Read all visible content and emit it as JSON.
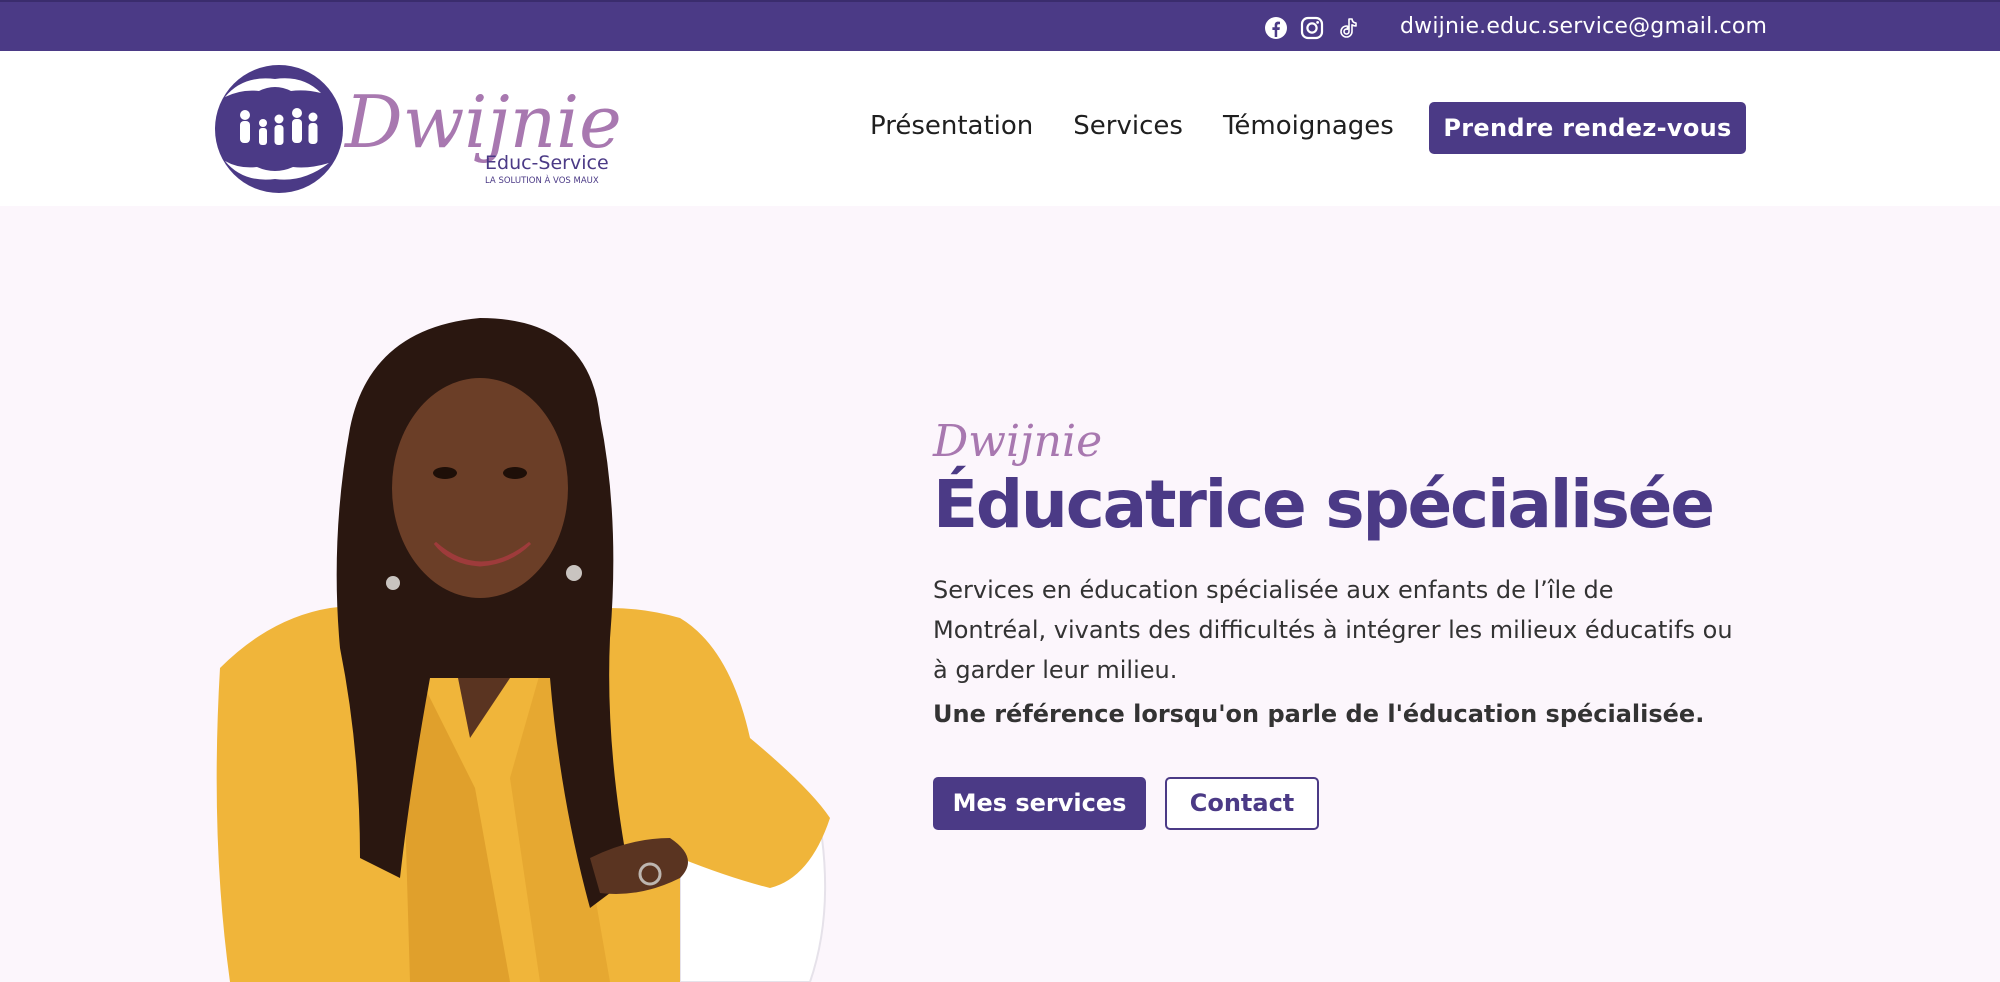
{
  "colors": {
    "brand_purple": "#4b3a86",
    "accent_lilac": "#a878b0",
    "hero_bg": "#fcf6fc",
    "jacket_yellow": "#f0b53a"
  },
  "topbar": {
    "social_icons": [
      "facebook-icon",
      "instagram-icon",
      "tiktok-icon"
    ],
    "email": "dwijnie.educ.service@gmail.com"
  },
  "logo": {
    "script_name": "Dwijnie",
    "brand": "Educ-Service",
    "slogan": "LA SOLUTION À VOS MAUX"
  },
  "nav": {
    "items": [
      "Présentation",
      "Services",
      "Témoignages"
    ],
    "cta_label": "Prendre rendez-vous"
  },
  "hero": {
    "kicker": "Dwijnie",
    "headline": "Éducatrice spécialisée",
    "description": "Services en éducation spécialisée aux enfants de l’île de Montréal, vivants des difficultés à intégrer les milieux éducatifs ou à garder leur milieu.",
    "tagline": "Une référence lorsqu'on parle de l'éducation spécialisée.",
    "primary_button": "Mes services",
    "secondary_button": "Contact"
  }
}
